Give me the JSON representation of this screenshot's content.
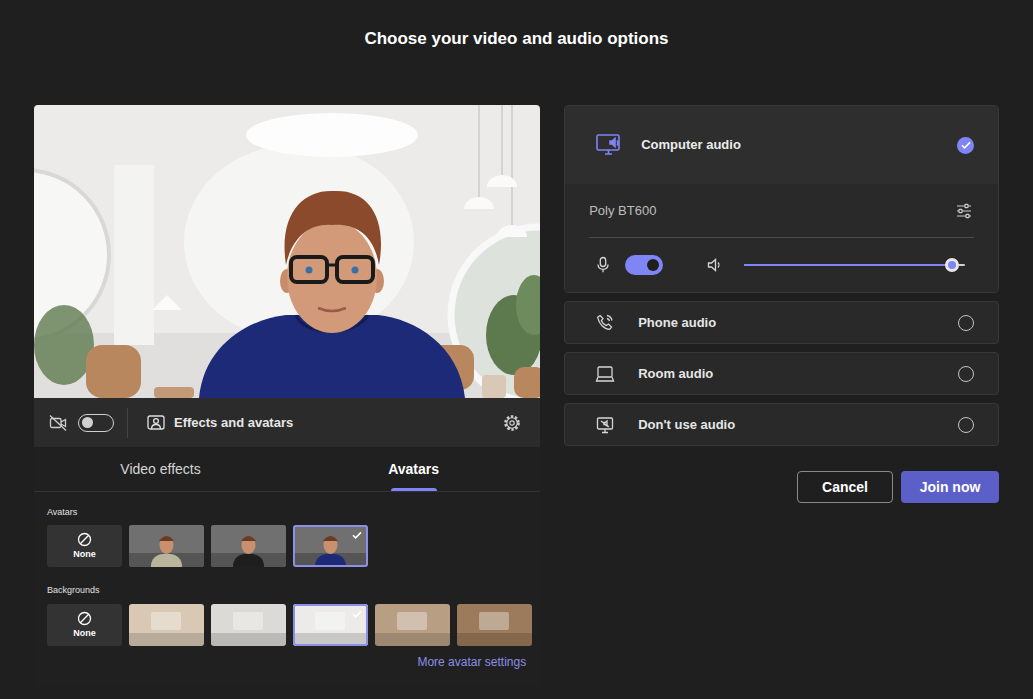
{
  "title": "Choose your video and audio options",
  "video": {
    "camera_on": false,
    "effects_label": "Effects and avatars"
  },
  "effects_tabs": [
    {
      "label": "Video effects",
      "selected": false
    },
    {
      "label": "Avatars",
      "selected": true
    }
  ],
  "avatars": {
    "label": "Avatars",
    "items": [
      {
        "kind": "none",
        "label": "None",
        "selected": false
      },
      {
        "kind": "avatar",
        "color": "#b9b59c",
        "selected": false
      },
      {
        "kind": "avatar",
        "color": "#1e1e1e",
        "selected": false
      },
      {
        "kind": "avatar",
        "color": "#1c2a78",
        "selected": true
      }
    ]
  },
  "backgrounds": {
    "label": "Backgrounds",
    "items": [
      {
        "kind": "none",
        "label": "None",
        "selected": false
      },
      {
        "kind": "scene",
        "color": "#d9c9b4",
        "selected": false
      },
      {
        "kind": "scene",
        "color": "#dcdad6",
        "selected": false
      },
      {
        "kind": "scene",
        "color": "#ecebe9",
        "selected": true
      },
      {
        "kind": "scene",
        "color": "#b89f84",
        "selected": false
      },
      {
        "kind": "scene",
        "color": "#9c7b5c",
        "selected": false
      }
    ]
  },
  "more_link": "More avatar settings",
  "audio": {
    "options": [
      {
        "label": "Computer audio",
        "kind": "computer",
        "selected": true
      },
      {
        "label": "Phone audio",
        "kind": "phone",
        "selected": false
      },
      {
        "label": "Room audio",
        "kind": "room",
        "selected": false
      },
      {
        "label": "Don't use audio",
        "kind": "none",
        "selected": false
      }
    ],
    "computer": {
      "device": "Poly BT600",
      "mic_on": true,
      "volume": {
        "level": 0.94
      }
    }
  },
  "buttons": [
    {
      "label": "Cancel",
      "kind": "secondary"
    },
    {
      "label": "Join now",
      "kind": "primary"
    }
  ]
}
